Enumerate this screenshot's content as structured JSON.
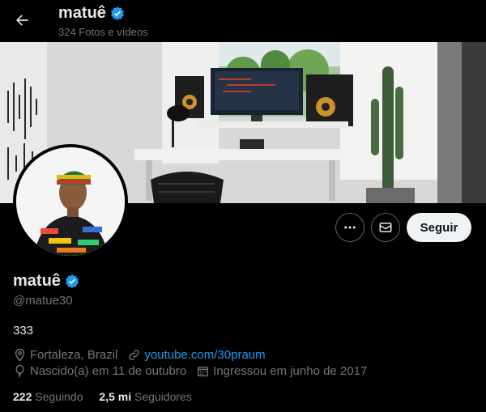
{
  "header": {
    "name": "matuê",
    "subtitle": "324 Fotos e vídeos"
  },
  "profile": {
    "name": "matuê",
    "handle": "@matue30",
    "bio": "333",
    "location": "Fortaleza, Brazil",
    "website": "youtube.com/30praum",
    "birthday": "Nascido(a) em 11 de outubro",
    "joined": "Ingressou em junho de 2017",
    "following_count": "222",
    "following_label": "Seguindo",
    "followers_count": "2,5 mi",
    "followers_label": "Seguidores"
  },
  "actions": {
    "follow_label": "Seguir"
  },
  "icons": {
    "back": "arrow-left-icon",
    "verified": "verified-badge-icon",
    "more": "more-icon",
    "message": "mail-icon",
    "location": "location-pin-icon",
    "link": "link-icon",
    "birthday": "balloon-icon",
    "calendar": "calendar-icon"
  },
  "colors": {
    "accent": "#1d9bf0",
    "background": "#000000",
    "muted": "#71767b",
    "text": "#e7e9ea"
  }
}
